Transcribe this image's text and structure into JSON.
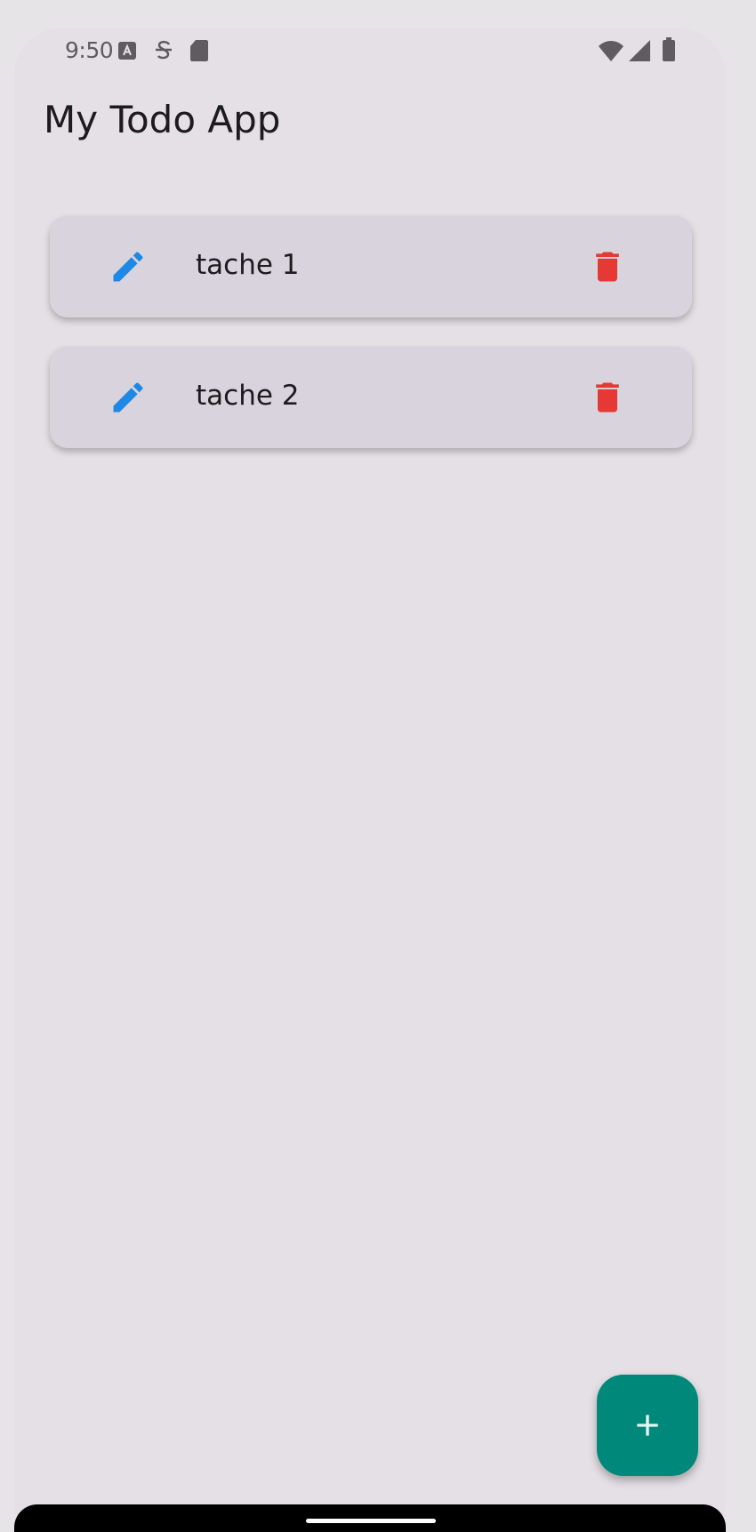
{
  "status_bar": {
    "time": "9:50",
    "left_icons": [
      "notification-app-icon",
      "notification-strike-icon",
      "sd-card-icon"
    ],
    "right_icons": [
      "wifi-icon",
      "cell-signal-icon",
      "battery-icon"
    ]
  },
  "app_bar": {
    "title": "My Todo App"
  },
  "todos": [
    {
      "label": "tache 1",
      "edit_icon": "edit-icon",
      "delete_icon": "delete-icon"
    },
    {
      "label": "tache 2",
      "edit_icon": "edit-icon",
      "delete_icon": "delete-icon"
    }
  ],
  "fab": {
    "icon": "add-icon"
  },
  "colors": {
    "background": "#e5e0e5",
    "card": "#d8d3dc",
    "edit_icon": "#1e88e5",
    "delete_icon": "#e53935",
    "fab": "#00897b"
  }
}
